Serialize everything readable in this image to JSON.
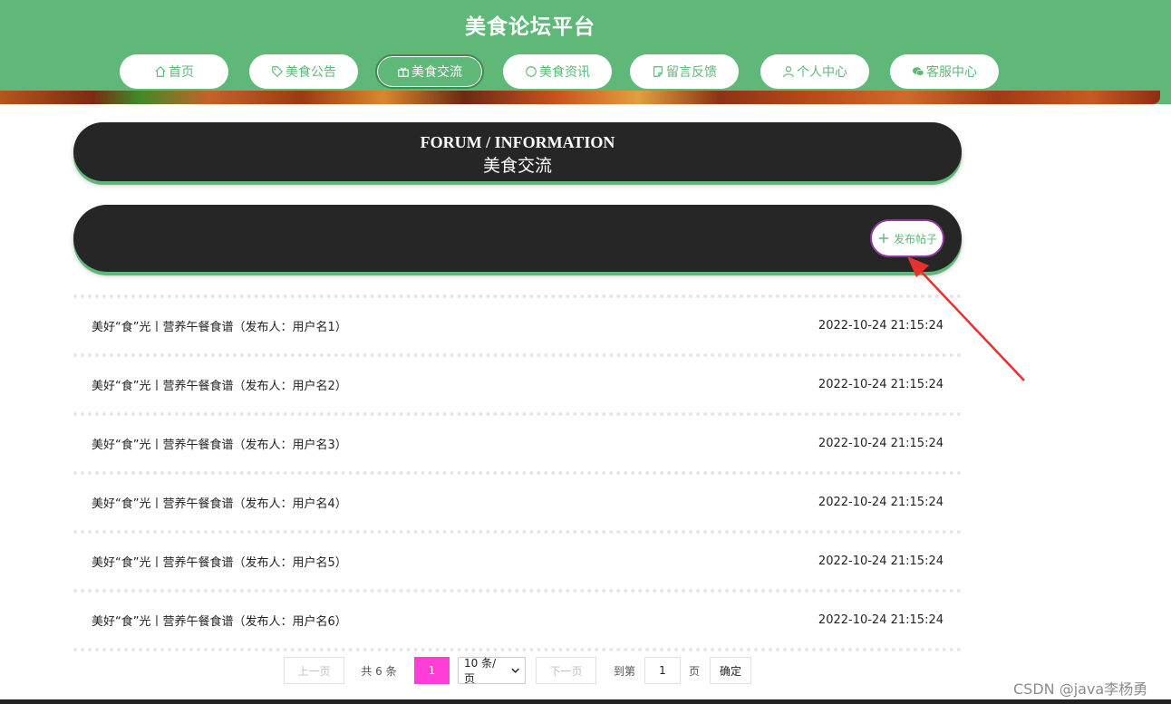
{
  "site": {
    "title": "美食论坛平台"
  },
  "nav": [
    {
      "label": "首页",
      "icon": "home-icon"
    },
    {
      "label": "美食公告",
      "icon": "tag-icon"
    },
    {
      "label": "美食交流",
      "icon": "gift-icon",
      "active": true
    },
    {
      "label": "美食资讯",
      "icon": "circle-icon"
    },
    {
      "label": "留言反馈",
      "icon": "note-icon"
    },
    {
      "label": "个人中心",
      "icon": "user-icon"
    },
    {
      "label": "客服中心",
      "icon": "wechat-icon"
    }
  ],
  "section": {
    "title_en": "FORUM / INFORMATION",
    "title_zh": "美食交流"
  },
  "publish_button": {
    "label": "发布帖子",
    "icon": "plus-icon"
  },
  "posts": [
    {
      "title": "美好“食”光丨营养午餐食谱（发布人：用户名1）",
      "time": "2022-10-24 21:15:24"
    },
    {
      "title": "美好“食”光丨营养午餐食谱（发布人：用户名2）",
      "time": "2022-10-24 21:15:24"
    },
    {
      "title": "美好“食”光丨营养午餐食谱（发布人：用户名3）",
      "time": "2022-10-24 21:15:24"
    },
    {
      "title": "美好“食”光丨营养午餐食谱（发布人：用户名4）",
      "time": "2022-10-24 21:15:24"
    },
    {
      "title": "美好“食”光丨营养午餐食谱（发布人：用户名5）",
      "time": "2022-10-24 21:15:24"
    },
    {
      "title": "美好“食”光丨营养午餐食谱（发布人：用户名6）",
      "time": "2022-10-24 21:15:24"
    }
  ],
  "pagination": {
    "prev": "上一页",
    "total": "共 6 条",
    "current": "1",
    "page_size": "10 条/页",
    "next": "下一页",
    "goto_label": "到第",
    "goto_value": "1",
    "page_unit": "页",
    "confirm": "确定"
  },
  "watermark": "CSDN @java李杨勇",
  "colors": {
    "primary": "#5fb878",
    "panel": "#262626",
    "current_page": "#ff3ed8",
    "annotation_arrow": "#e8302e"
  }
}
